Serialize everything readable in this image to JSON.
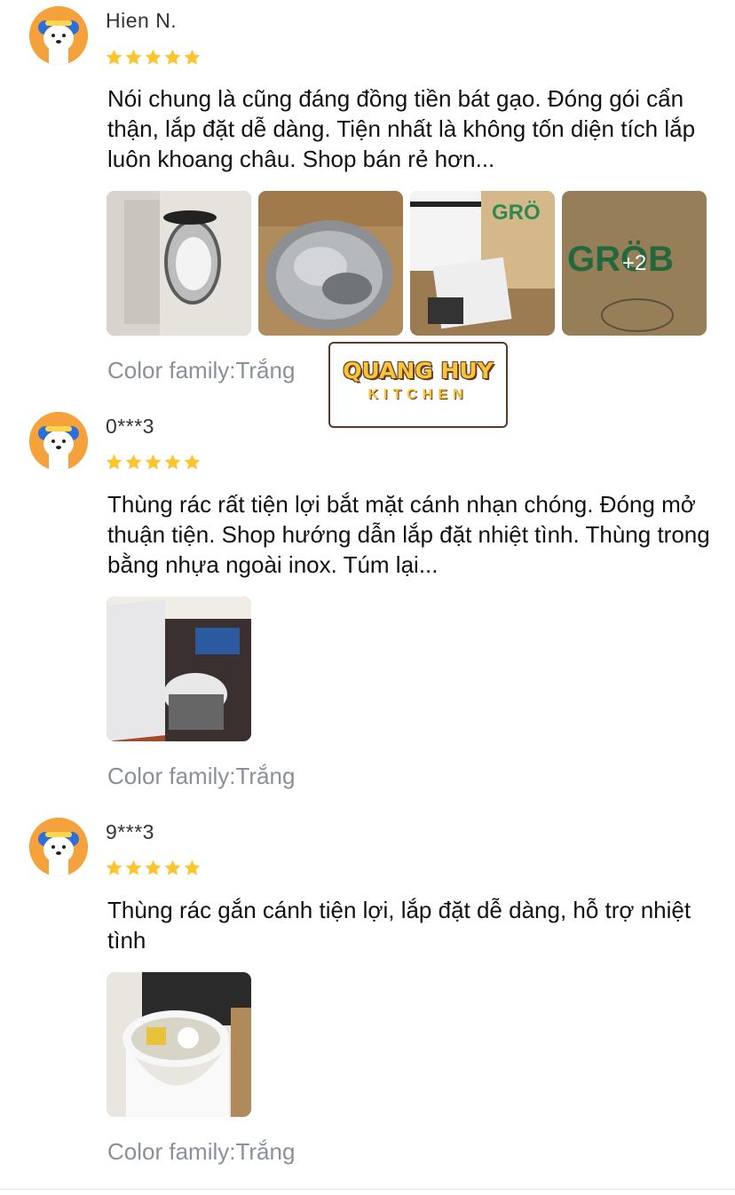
{
  "colors": {
    "star": "#fdc52d",
    "variant_text": "#8a8f99",
    "avatar_bg": "#f6a23c"
  },
  "watermark": {
    "line1": "QUANG HUY",
    "line2": "KITCHEN"
  },
  "reviews": [
    {
      "name": "Hien N.",
      "rating": 5,
      "text": "Nói chung là cũng đáng đồng tiền bát gạo. Đóng gói cẩn thận, lắp đặt dễ dàng. Tiện nhất là không tốn diện tích lắp luôn khoang châu. Shop bán rẻ hơn...",
      "more_photos": "+2",
      "variant": "Color family:Trắng"
    },
    {
      "name": "0***3",
      "rating": 5,
      "text": "Thùng rác rất tiện lợi bắt mặt cánh nhạn chóng. Đóng mở thuận tiện. Shop hướng dẫn lắp đặt nhiệt tình. Thùng  trong bằng nhựa ngoài inox. Túm lại...",
      "variant": "Color family:Trắng"
    },
    {
      "name": "9***3",
      "rating": 5,
      "text": "Thùng rác gắn cánh tiện lợi, lắp đặt dễ dàng, hỗ trợ nhiệt tình",
      "variant": "Color family:Trắng"
    }
  ]
}
